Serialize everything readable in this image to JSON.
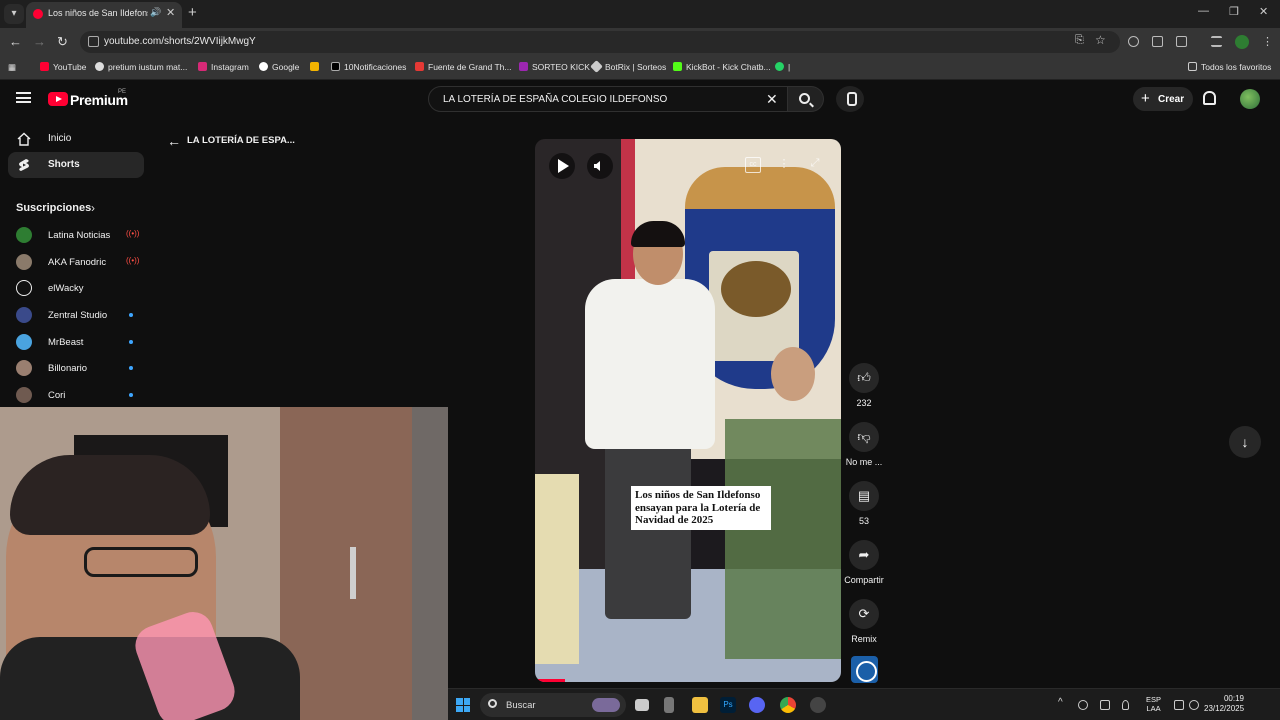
{
  "browser": {
    "tab_title": "Los niños de San Ildefonso",
    "url": "youtube.com/shorts/2WVIijkMwgY",
    "bookmarks": [
      "YouTube",
      "pretium iustum mat...",
      "Instagram",
      "Google",
      "10Notificaciones",
      "Fuente de Grand Th...",
      "SORTEO KICK",
      "BotRix | Sorteos",
      "KickBot - Kick Chatb...",
      "|"
    ],
    "all_bookmarks": "Todos los favoritos"
  },
  "header": {
    "brand": "Premium",
    "country": "PE",
    "search_value": "LA LOTERÍA DE ESPAÑA COLEGIO ILDEFONSO",
    "create_label": "Crear"
  },
  "sidebar": {
    "items": [
      {
        "label": "Inicio",
        "icon": "home-icon"
      },
      {
        "label": "Shorts",
        "icon": "shorts-icon"
      }
    ],
    "subscriptions_title": "Suscripciones",
    "subscriptions": [
      {
        "name": "Latina Noticias",
        "status": "live"
      },
      {
        "name": "AKA Fanodric",
        "status": "live"
      },
      {
        "name": "elWacky",
        "status": ""
      },
      {
        "name": "Zentral Studio",
        "status": "new"
      },
      {
        "name": "MrBeast",
        "status": "new"
      },
      {
        "name": "Billonario",
        "status": "new"
      },
      {
        "name": "Cori",
        "status": "new"
      }
    ]
  },
  "shorts": {
    "back_label": "LA LOTERÍA DE ESPA...",
    "caption": "Los niños de San Ildefonso ensayan para la Lotería de Navidad de 2025",
    "actions": {
      "likes": "232",
      "dislike_label": "No me ...",
      "comments": "53",
      "share_label": "Compartir",
      "remix_label": "Remix"
    }
  },
  "taskbar": {
    "search_label": "Buscar",
    "lang_line1": "ESP",
    "lang_line2": "LAA",
    "time": "00:19",
    "date": "23/12/2025"
  },
  "colors": {
    "youtube_red": "#ff0033",
    "background": "#0f0f0f",
    "accent_blue": "#3ea6ff",
    "live_red": "#ff4e45"
  }
}
